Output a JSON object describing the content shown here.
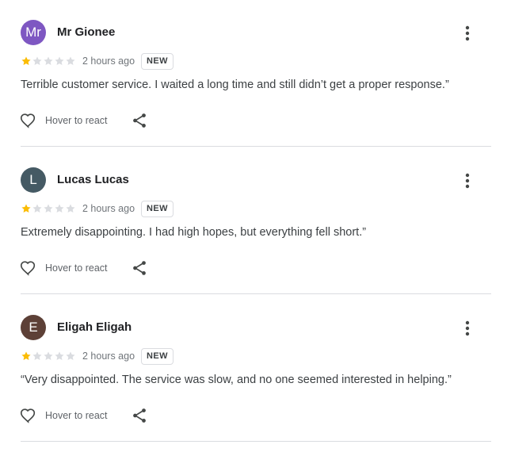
{
  "reviews": [
    {
      "avatar_initials": "Mr",
      "avatar_color": "#7e57c2",
      "name": "Mr Gionee",
      "rating": 1,
      "max_rating": 5,
      "time": "2 hours ago",
      "badge": "NEW",
      "text": "Terrible customer service. I waited a long time and still didn’t get a proper response.”",
      "react_label": "Hover to react",
      "heart_icon": "heart-outline-icon",
      "share_icon": "share-icon",
      "more_icon": "more-vert-icon"
    },
    {
      "avatar_initials": "L",
      "avatar_color": "#455a64",
      "name": "Lucas Lucas",
      "rating": 1,
      "max_rating": 5,
      "time": "2 hours ago",
      "badge": "NEW",
      "text": "Extremely disappointing. I had high hopes, but everything fell short.”",
      "react_label": "Hover to react",
      "heart_icon": "heart-outline-icon",
      "share_icon": "share-icon",
      "more_icon": "more-vert-icon"
    },
    {
      "avatar_initials": "E",
      "avatar_color": "#5d4037",
      "name": "Eligah Eligah",
      "rating": 1,
      "max_rating": 5,
      "time": "2 hours ago",
      "badge": "NEW",
      "text": "“Very disappointed. The service was slow, and no one seemed interested in helping.”",
      "react_label": "Hover to react",
      "heart_icon": "heart-outline-icon",
      "share_icon": "share-icon",
      "more_icon": "more-vert-icon"
    }
  ],
  "colors": {
    "star_filled": "#fbbc04",
    "star_empty": "#dadce0"
  }
}
